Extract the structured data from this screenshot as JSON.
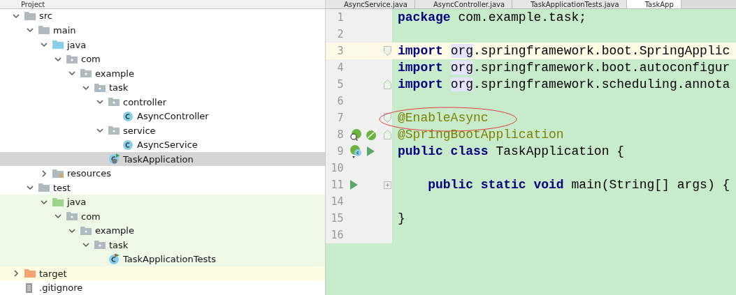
{
  "project_panel": {
    "title": "Project",
    "tree": [
      {
        "label": "src",
        "kind": "folder",
        "expanded": true,
        "selected": false,
        "children": [
          {
            "label": "main",
            "kind": "folder",
            "expanded": true,
            "selected": false,
            "children": [
              {
                "label": "java",
                "kind": "source-root",
                "expanded": true,
                "selected": false,
                "children": [
                  {
                    "label": "com",
                    "kind": "package",
                    "expanded": true,
                    "selected": false,
                    "children": [
                      {
                        "label": "example",
                        "kind": "package",
                        "expanded": true,
                        "selected": false,
                        "children": [
                          {
                            "label": "task",
                            "kind": "package",
                            "expanded": true,
                            "selected": false,
                            "children": [
                              {
                                "label": "controller",
                                "kind": "package",
                                "expanded": true,
                                "selected": false,
                                "children": [
                                  {
                                    "label": "AsyncController",
                                    "kind": "class",
                                    "selected": false
                                  }
                                ]
                              },
                              {
                                "label": "service",
                                "kind": "package",
                                "expanded": true,
                                "selected": false,
                                "children": [
                                  {
                                    "label": "AsyncService",
                                    "kind": "class",
                                    "selected": false
                                  }
                                ]
                              },
                              {
                                "label": "TaskApplication",
                                "kind": "spring-class",
                                "selected": true
                              }
                            ]
                          }
                        ]
                      }
                    ]
                  }
                ]
              },
              {
                "label": "resources",
                "kind": "resources",
                "expanded": false,
                "selected": false
              }
            ]
          },
          {
            "label": "test",
            "kind": "folder",
            "expanded": true,
            "selected": false,
            "children": [
              {
                "label": "java",
                "kind": "test-root",
                "in_test": true,
                "expanded": true,
                "selected": false,
                "children": [
                  {
                    "label": "com",
                    "kind": "package",
                    "in_test": true,
                    "expanded": true,
                    "selected": false,
                    "children": [
                      {
                        "label": "example",
                        "kind": "package",
                        "in_test": true,
                        "expanded": true,
                        "selected": false,
                        "children": [
                          {
                            "label": "task",
                            "kind": "package",
                            "in_test": true,
                            "expanded": true,
                            "selected": false,
                            "children": [
                              {
                                "label": "TaskApplicationTests",
                                "kind": "test-class",
                                "in_test": true,
                                "selected": false
                              }
                            ]
                          }
                        ]
                      }
                    ]
                  }
                ]
              }
            ]
          }
        ]
      },
      {
        "label": "target",
        "kind": "excluded",
        "excluded": true,
        "expanded": false,
        "selected": false
      },
      {
        "label": ".gitignore",
        "kind": "file",
        "selected": false
      }
    ]
  },
  "editor": {
    "tabs": [
      {
        "label": "AsyncService.java",
        "selected": false
      },
      {
        "label": "AsyncController.java",
        "selected": false
      },
      {
        "label": "TaskApplicationTests.java",
        "selected": false
      },
      {
        "label": "TaskApp",
        "selected": true
      }
    ],
    "lines": [
      {
        "number": "1",
        "current": false,
        "tokens": [
          {
            "kind": "keyword",
            "text": "package "
          },
          {
            "kind": "plain",
            "text": "com.example.task;"
          }
        ]
      },
      {
        "number": "2",
        "current": false
      },
      {
        "number": "3",
        "current": true,
        "fold": {
          "kind": "start"
        },
        "tokens": [
          {
            "kind": "keyword",
            "text": "import "
          },
          {
            "kind": "match",
            "text": "org"
          },
          {
            "kind": "plain",
            "text": ".springframework.boot.SpringApplic"
          }
        ]
      },
      {
        "number": "4",
        "current": false,
        "tokens": [
          {
            "kind": "keyword",
            "text": "import "
          },
          {
            "kind": "match",
            "text": "org"
          },
          {
            "kind": "plain",
            "text": ".springframework.boot.autoconfigur"
          }
        ]
      },
      {
        "number": "5",
        "current": false,
        "fold": {
          "kind": "end"
        },
        "tokens": [
          {
            "kind": "keyword",
            "text": "import "
          },
          {
            "kind": "match",
            "text": "org"
          },
          {
            "kind": "plain",
            "text": ".springframework.scheduling.annota"
          }
        ]
      },
      {
        "number": "6",
        "current": false
      },
      {
        "number": "7",
        "current": false,
        "fold": {
          "kind": "start"
        },
        "circled": true,
        "tokens": [
          {
            "kind": "annotation",
            "text": "@EnableAsync"
          }
        ]
      },
      {
        "number": "8",
        "current": false,
        "fold": {
          "kind": "end"
        },
        "gutter": [
          {
            "kind": "bean-search"
          },
          {
            "kind": "spring"
          }
        ],
        "tokens": [
          {
            "kind": "annotation",
            "text": "@SpringBootApplication"
          }
        ]
      },
      {
        "number": "9",
        "current": false,
        "gutter": [
          {
            "kind": "spring-class"
          },
          {
            "kind": "run"
          }
        ],
        "tokens": [
          {
            "kind": "keyword",
            "text": "public class "
          },
          {
            "kind": "plain",
            "text": "TaskApplication {"
          }
        ]
      },
      {
        "number": "10",
        "current": false
      },
      {
        "number": "11",
        "current": false,
        "fold": {
          "kind": "collapsed"
        },
        "gutter": [
          {
            "kind": "run"
          }
        ],
        "tokens": [
          {
            "kind": "keyword",
            "text": "    public static void "
          },
          {
            "kind": "plain",
            "text": "main(String[] args) {"
          }
        ]
      },
      {
        "number": "14",
        "current": false
      },
      {
        "number": "15",
        "current": false,
        "tokens": [
          {
            "kind": "plain",
            "text": "}"
          }
        ]
      },
      {
        "number": "16",
        "current": false
      }
    ]
  }
}
